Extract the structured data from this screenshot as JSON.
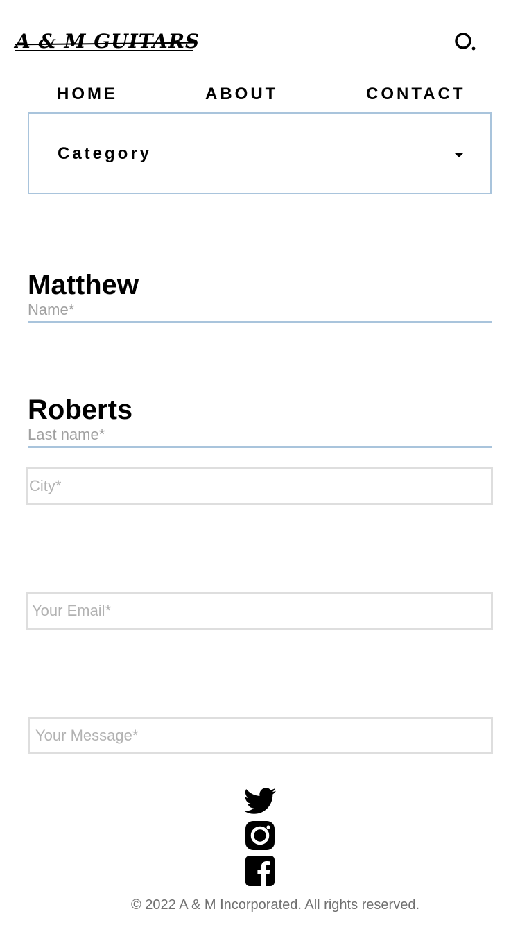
{
  "header": {
    "logo_text": "A & M GUITARS",
    "search_icon": "search-icon"
  },
  "nav": {
    "items": [
      {
        "label": "HOME"
      },
      {
        "label": "ABOUT"
      },
      {
        "label": "CONTACT"
      }
    ]
  },
  "form": {
    "category": {
      "label": "Category",
      "icon": "caret-down-icon"
    },
    "first_name": {
      "value": "Matthew",
      "label": "Name*"
    },
    "last_name": {
      "value": "Roberts",
      "label": "Last name*"
    },
    "city": {
      "placeholder": "City*",
      "value": ""
    },
    "email": {
      "placeholder": "Your Email*",
      "value": ""
    },
    "message": {
      "placeholder": "Your Message*",
      "value": ""
    }
  },
  "social": {
    "icons": [
      "twitter-icon",
      "instagram-icon",
      "facebook-icon"
    ]
  },
  "footer": {
    "copyright": "© 2022 A & M Incorporated. All rights reserved."
  },
  "colors": {
    "accent_border": "#a9c4dc",
    "input_border": "#dedede",
    "placeholder": "#b2b2b2",
    "footer_text": "#707070"
  }
}
